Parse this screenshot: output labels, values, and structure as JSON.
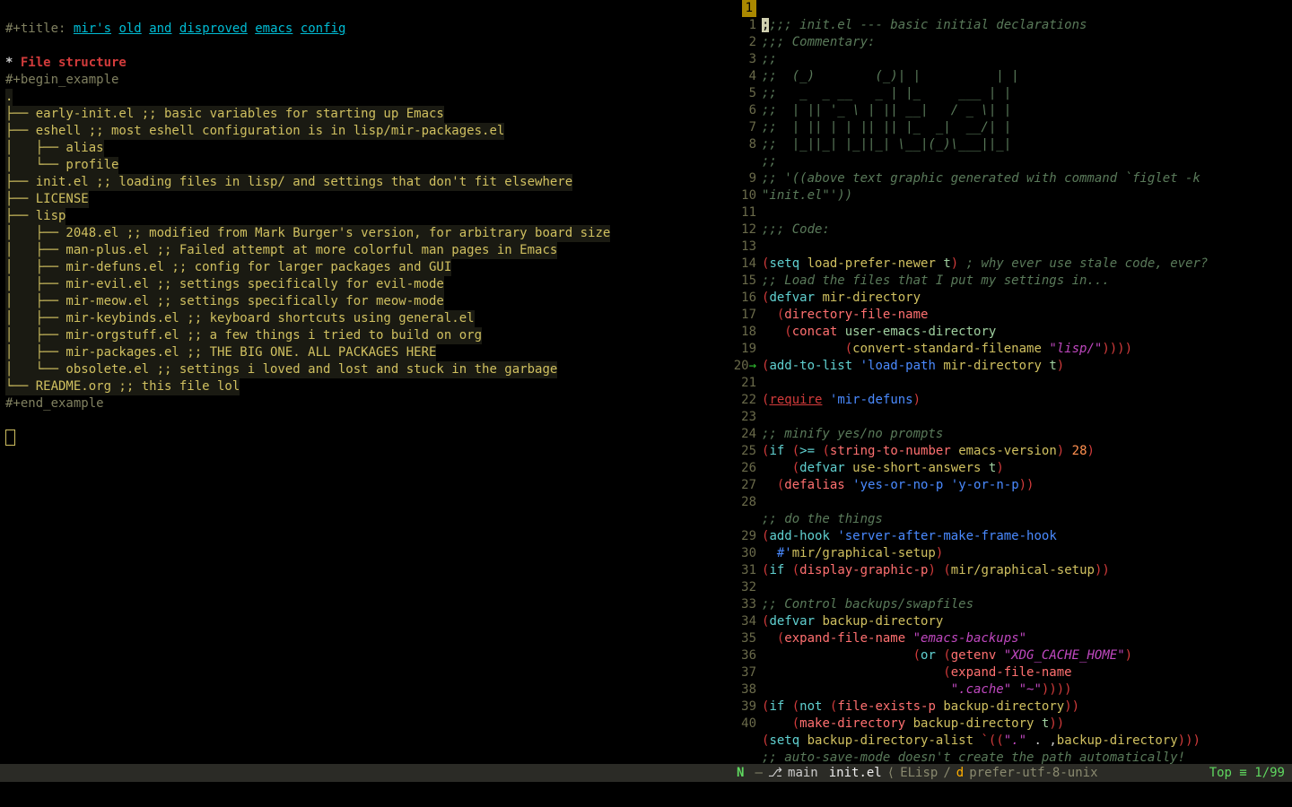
{
  "left": {
    "title_prefix": "#+title: ",
    "title_words": [
      "mir's",
      "old",
      "and",
      "disproved",
      "emacs",
      "config"
    ],
    "heading": "File structure",
    "begin": "#+begin_example",
    "end": "#+end_example",
    "tree": [
      ".",
      "├── early-init.el ;; basic variables for starting up Emacs",
      "├── eshell ;; most eshell configuration is in lisp/mir-packages.el",
      "│   ├── alias",
      "│   └── profile",
      "├── init.el ;; loading files in lisp/ and settings that don't fit elsewhere",
      "├── LICENSE",
      "├── lisp",
      "│   ├── 2048.el ;; modified from Mark Burger's version, for arbitrary board size",
      "│   ├── man-plus.el ;; Failed attempt at more colorful man pages in Emacs",
      "│   ├── mir-defuns.el ;; config for larger packages and GUI",
      "│   ├── mir-evil.el ;; settings specifically for evil-mode",
      "│   ├── mir-meow.el ;; settings specifically for meow-mode",
      "│   ├── mir-keybinds.el ;; keyboard shortcuts using general.el",
      "│   ├── mir-orgstuff.el ;; a few things i tried to build on org",
      "│   ├── mir-packages.el ;; THE BIG ONE. ALL PACKAGES HERE",
      "│   └── obsolete.el ;; settings i loved and lost and stuck in the garbage",
      "└── README.org ;; this file lol"
    ]
  },
  "right": {
    "lines": [
      {
        "n": "1",
        "cur": true
      },
      {
        "n": "1"
      },
      {
        "n": "2"
      },
      {
        "n": "3"
      },
      {
        "n": "4"
      },
      {
        "n": "5"
      },
      {
        "n": "6"
      },
      {
        "n": "7"
      },
      {
        "n": "8"
      },
      {
        "n": ""
      },
      {
        "n": "9"
      },
      {
        "n": "10"
      },
      {
        "n": "11"
      },
      {
        "n": "12"
      },
      {
        "n": "13"
      },
      {
        "n": "14"
      },
      {
        "n": "15"
      },
      {
        "n": "16"
      },
      {
        "n": "17"
      },
      {
        "n": "18"
      },
      {
        "n": "19"
      },
      {
        "n": "20",
        "arrow": true
      },
      {
        "n": "21"
      },
      {
        "n": "22"
      },
      {
        "n": "23"
      },
      {
        "n": "24"
      },
      {
        "n": "25"
      },
      {
        "n": "26"
      },
      {
        "n": "27"
      },
      {
        "n": "28"
      },
      {
        "n": ""
      },
      {
        "n": "29"
      },
      {
        "n": "30"
      },
      {
        "n": "31"
      },
      {
        "n": "32"
      },
      {
        "n": "33"
      },
      {
        "n": "34"
      },
      {
        "n": "35"
      },
      {
        "n": "36"
      },
      {
        "n": "37"
      },
      {
        "n": "38"
      },
      {
        "n": "39"
      },
      {
        "n": "40"
      }
    ],
    "c": {
      "l0": ";;; init.el --- basic initial declarations",
      "l1": ";;; Commentary:",
      "l2": ";;",
      "l3": ";;  (_)        (_)| |          | |",
      "l4": ";;   _  _ __   _ | |_     ___ | |",
      "l5": ";;  | || '_ \\ | || __|   / _ \\| |",
      "l6": ";;  | || | | || || |_  _|  __/| |",
      "l7": ";;  |_||_| |_||_| \\__|(_)\\___||_|",
      "l8": ";;",
      "l9a": ";; '((above text graphic generated with command `figlet -k ",
      "l9b": "\"init.el\"",
      "l9c": "'))",
      "l10": "",
      "code_cm": ";;; Code:",
      "l12a": "setq",
      "l12b": "load-prefer-newer",
      "l12c": "t",
      "l12d": "; why ever use stale code, ever?",
      "l13": ";; Load the files that I put my settings in...",
      "l14a": "defvar",
      "l14b": "mir-directory",
      "l15a": "directory-file-name",
      "l16a": "concat",
      "l16b": "user-emacs-directory",
      "l17a": "convert-standard-filename",
      "l17b": "\"lisp/\"",
      "l18a": "add-to-list",
      "l18b": "'load-path",
      "l18c": "mir-directory",
      "l18d": "t",
      "l20a": "require",
      "l20b": "'mir-defuns",
      "l22": ";; minify yes/no prompts",
      "l23a": "if",
      "l23b": ">=",
      "l23c": "string-to-number",
      "l23d": "emacs-version",
      "l23e": "28",
      "l24a": "defvar",
      "l24b": "use-short-answers",
      "l24c": "t",
      "l25a": "defalias",
      "l25b": "'yes-or-no-p",
      "l25c": "'y-or-n-p",
      "l27": ";; do the things",
      "l28a": "add-hook",
      "l28b": "'server-after-make-frame-hook",
      "l28c": "#'",
      "l28d": "mir/graphical-setup",
      "l29a": "if",
      "l29b": "display-graphic-p",
      "l29c": "mir/graphical-setup",
      "l31": ";; Control backups/swapfiles",
      "l32a": "defvar",
      "l32b": "backup-directory",
      "l33a": "expand-file-name",
      "l33b": "\"emacs-backups\"",
      "l34a": "or",
      "l34b": "getenv",
      "l34c": "\"XDG_CACHE_HOME\"",
      "l35a": "expand-file-name",
      "l36a": "\".cache\"",
      "l36b": "\"~\"",
      "l37a": "if",
      "l37b": "not",
      "l37c": "file-exists-p",
      "l37d": "backup-directory",
      "l38a": "make-directory",
      "l38b": "backup-directory",
      "l38c": "t",
      "l39a": "setq",
      "l39b": "backup-directory-alist",
      "l39c": "`((",
      "l39d": "\".\"",
      "l39e": " . ,",
      "l39f": "backup-directory",
      "l39g": ")))",
      "l40": ";; auto-save-mode doesn't create the path automatically!"
    }
  },
  "modeline": {
    "inactive": "",
    "state": "N",
    "sep1": "  —",
    "branch_icon": "⎇",
    "branch": "main",
    "sep2": "   ",
    "fname": "init.el",
    "sep3": " ⟨ ",
    "major": "ELisp",
    "slash": "/",
    "minor": "d",
    "enc": "   prefer-utf-8-unix",
    "pos": "Top ≡ 1/99"
  }
}
